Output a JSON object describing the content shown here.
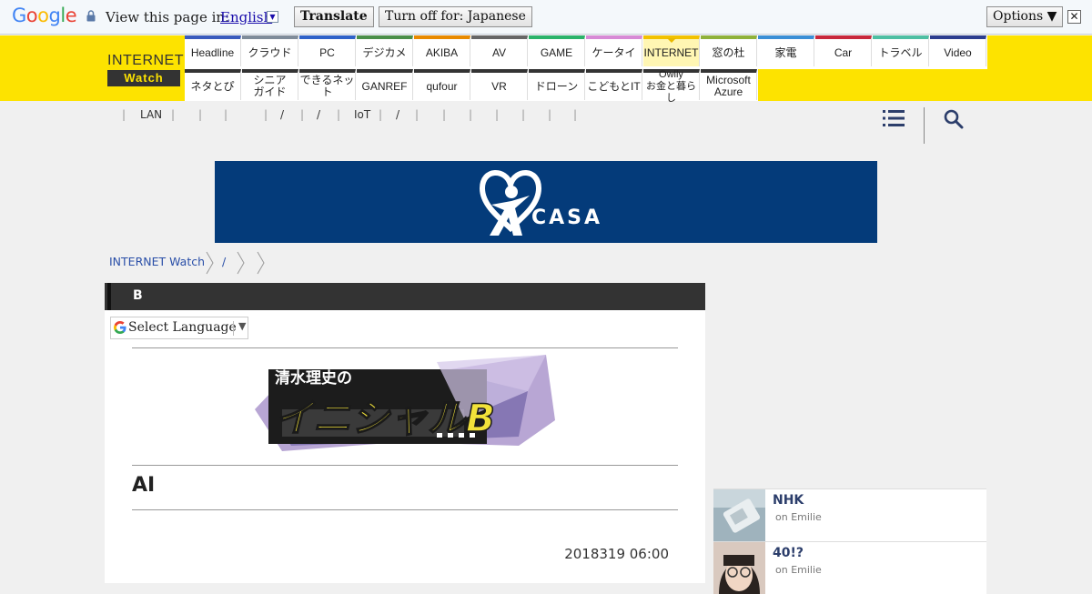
{
  "translate_bar": {
    "logo": "Google",
    "view_label": "View this page in:",
    "language": "English",
    "translate_button": "Translate",
    "turn_off_button": "Turn off for: Japanese",
    "options_button": "Options ▼",
    "close": "✕"
  },
  "site": {
    "logo_top": "INTERNET",
    "logo_bottom": "Watch"
  },
  "nav": {
    "row1": [
      {
        "label": "Headline",
        "color": "#3a5bbd"
      },
      {
        "label": "クラウド",
        "color": "#7f8c9a"
      },
      {
        "label": "PC",
        "color": "#2e62c9"
      },
      {
        "label": "デジカメ",
        "color": "#4a8f4a"
      },
      {
        "label": "AKIBA",
        "color": "#e88a00"
      },
      {
        "label": "AV",
        "color": "#666666"
      },
      {
        "label": "GAME",
        "color": "#2bb36a"
      },
      {
        "label": "ケータイ",
        "color": "#d78ad6"
      },
      {
        "label": "INTERNET",
        "color": "#f2c200",
        "active": true
      },
      {
        "label": "窓の杜",
        "color": "#8fb23a"
      },
      {
        "label": "家電",
        "color": "#3a8fd6"
      },
      {
        "label": "Car",
        "color": "#c8283c"
      },
      {
        "label": "トラベル",
        "color": "#4dbfa3"
      },
      {
        "label": "Video",
        "color": "#2c3e8f"
      }
    ],
    "row2": [
      {
        "label": "ネタとぴ"
      },
      {
        "label": "シニア\nガイド"
      },
      {
        "label": "できるネット"
      },
      {
        "label": "GANREF"
      },
      {
        "label": "qufour"
      },
      {
        "label": "VR"
      },
      {
        "label": "ドローン"
      },
      {
        "label": "こどもとIT"
      },
      {
        "label": "Owlly\nお金と暮らし"
      },
      {
        "label": "Microsoft\nAzure"
      }
    ]
  },
  "sub_nav": {
    "items": [
      "|",
      "LAN",
      "|",
      "|",
      "|",
      "|",
      "/",
      "|",
      "/",
      "|",
      "IoT",
      "|",
      "/",
      "|",
      "|",
      "|",
      "|",
      "|",
      "|",
      "|"
    ]
  },
  "ad": {
    "brand": "CASA",
    "background": "#043b7a"
  },
  "breadcrumb": {
    "home": "INTERNET Watch",
    "item2": "/"
  },
  "article": {
    "category": "B",
    "language_select": "Select Language",
    "banner_text_top": "清水理史の",
    "banner_text_main": "イニシャルB",
    "title": "AI",
    "date": "2018319 06:00"
  },
  "sidebar": {
    "items": [
      {
        "title": "NHK",
        "byline": "on Emilie"
      },
      {
        "title": "40!?",
        "byline": "on Emilie"
      }
    ]
  },
  "colors": {
    "brand_yellow": "#fde300",
    "link_blue": "#2a4fa8",
    "dark_header": "#333333"
  }
}
